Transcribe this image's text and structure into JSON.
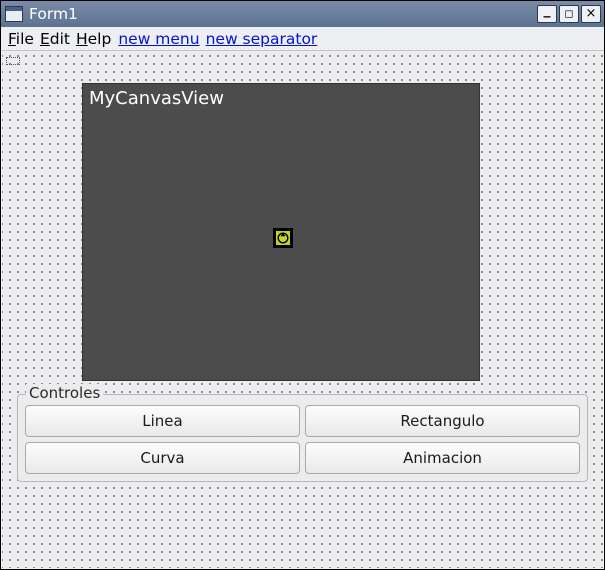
{
  "window": {
    "title": "Form1"
  },
  "menu": {
    "file": "File",
    "edit": "Edit",
    "help": "Help",
    "new_menu": "new menu",
    "new_separator": "new separator"
  },
  "canvas": {
    "label": "MyCanvasView"
  },
  "controles": {
    "legend": "Controles",
    "linea": "Linea",
    "rectangulo": "Rectangulo",
    "curva": "Curva",
    "animacion": "Animacion"
  }
}
